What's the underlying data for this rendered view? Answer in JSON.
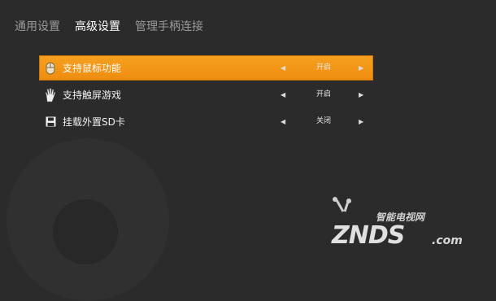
{
  "tabs": [
    {
      "label": "通用设置",
      "active": false
    },
    {
      "label": "高级设置",
      "active": true
    },
    {
      "label": "管理手柄连接",
      "active": false
    }
  ],
  "menu": [
    {
      "label": "支持鼠标功能",
      "value": "开启",
      "icon": "mouse-icon",
      "selected": true
    },
    {
      "label": "支持触屏游戏",
      "value": "开启",
      "icon": "hand-icon",
      "selected": false
    },
    {
      "label": "挂载外置SD卡",
      "value": "关闭",
      "icon": "save-disk-icon",
      "selected": false
    }
  ],
  "arrows": {
    "left": "◀",
    "right": "▶"
  },
  "watermark": {
    "sub": "智能电视网",
    "main": "ZNDS",
    "suffix": ".com"
  },
  "colors": {
    "accent": "#f39a1a",
    "background": "#2b2b2b"
  }
}
